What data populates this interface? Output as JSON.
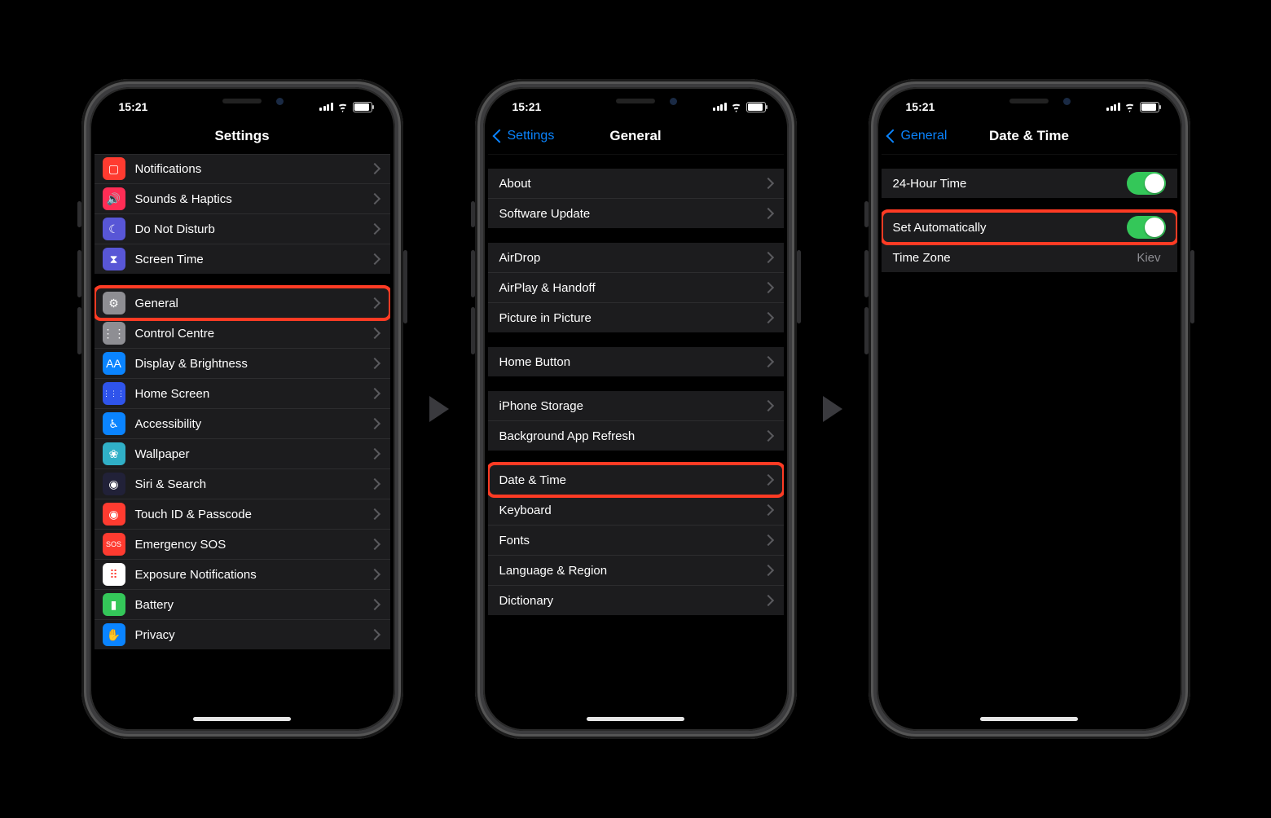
{
  "status": {
    "time": "15:21"
  },
  "phone1": {
    "title": "Settings",
    "groups": [
      {
        "tight": true,
        "rows": [
          {
            "label": "Notifications",
            "iconBg": "#ff3b30",
            "glyph": "notifications-icon",
            "glyphText": "▢"
          },
          {
            "label": "Sounds & Haptics",
            "iconBg": "#ff2d55",
            "glyph": "sounds-icon",
            "glyphText": "🔊"
          },
          {
            "label": "Do Not Disturb",
            "iconBg": "#5856d6",
            "glyph": "moon-icon",
            "glyphText": "☾"
          },
          {
            "label": "Screen Time",
            "iconBg": "#5856d6",
            "glyph": "hourglass-icon",
            "glyphText": "⧗"
          }
        ]
      },
      {
        "rows": [
          {
            "label": "General",
            "iconBg": "#8e8e93",
            "glyph": "gear-icon",
            "glyphText": "⚙",
            "hl": true
          },
          {
            "label": "Control Centre",
            "iconBg": "#8e8e93",
            "glyph": "switches-icon",
            "glyphText": "⋮⋮"
          },
          {
            "label": "Display & Brightness",
            "iconBg": "#0a84ff",
            "glyph": "brightness-icon",
            "glyphText": "AA"
          },
          {
            "label": "Home Screen",
            "iconBg": "#2f54eb",
            "glyph": "grid-icon",
            "glyphText": "⋮⋮⋮"
          },
          {
            "label": "Accessibility",
            "iconBg": "#0a84ff",
            "glyph": "accessibility-icon",
            "glyphText": "♿︎"
          },
          {
            "label": "Wallpaper",
            "iconBg": "#30b0c7",
            "glyph": "wallpaper-icon",
            "glyphText": "❀"
          },
          {
            "label": "Siri & Search",
            "iconBg": "#212138",
            "glyph": "siri-icon",
            "glyphText": "◉"
          },
          {
            "label": "Touch ID & Passcode",
            "iconBg": "#ff3b30",
            "glyph": "fingerprint-icon",
            "glyphText": "◉"
          },
          {
            "label": "Emergency SOS",
            "iconBg": "#ff3b30",
            "glyph": "sos-icon",
            "glyphText": "SOS"
          },
          {
            "label": "Exposure Notifications",
            "iconBg": "#ffffff",
            "glyph": "exposure-icon",
            "glyphText": "⠿",
            "fg": "#ff3b30"
          },
          {
            "label": "Battery",
            "iconBg": "#34c759",
            "glyph": "battery-icon",
            "glyphText": "▮"
          },
          {
            "label": "Privacy",
            "iconBg": "#0a84ff",
            "glyph": "hand-icon",
            "glyphText": "✋"
          }
        ]
      }
    ]
  },
  "phone2": {
    "title": "General",
    "back": "Settings",
    "groups": [
      {
        "rows": [
          {
            "label": "About"
          },
          {
            "label": "Software Update"
          }
        ]
      },
      {
        "rows": [
          {
            "label": "AirDrop"
          },
          {
            "label": "AirPlay & Handoff"
          },
          {
            "label": "Picture in Picture"
          }
        ]
      },
      {
        "rows": [
          {
            "label": "Home Button"
          }
        ]
      },
      {
        "rows": [
          {
            "label": "iPhone Storage"
          },
          {
            "label": "Background App Refresh"
          }
        ]
      },
      {
        "rows": [
          {
            "label": "Date & Time",
            "hl": true
          },
          {
            "label": "Keyboard"
          },
          {
            "label": "Fonts"
          },
          {
            "label": "Language & Region"
          },
          {
            "label": "Dictionary"
          }
        ]
      }
    ]
  },
  "phone3": {
    "title": "Date & Time",
    "back": "General",
    "groups": [
      {
        "rows": [
          {
            "label": "24-Hour Time",
            "toggle": true
          }
        ]
      },
      {
        "rows": [
          {
            "label": "Set Automatically",
            "toggle": true,
            "hl": true
          },
          {
            "label": "Time Zone",
            "value": "Kiev",
            "noChevron": true
          }
        ]
      }
    ]
  }
}
